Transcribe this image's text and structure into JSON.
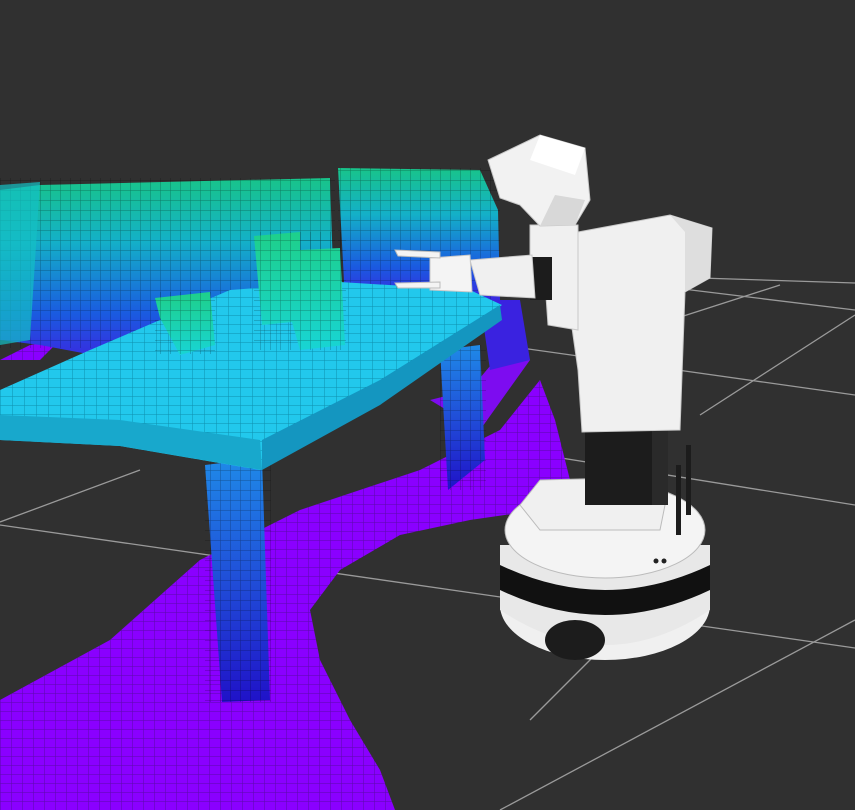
{
  "viewport": {
    "background": "#303030",
    "grid_color": "#a0a0a0"
  },
  "octomap": {
    "color_scheme": "height",
    "colors": {
      "floor": "#8a00ff",
      "floor_low": "#7a14e8",
      "table_leg_low": "#1a2bd8",
      "table_leg_high": "#1f7fe8",
      "table_top": "#22c8ec",
      "wall_low": "#1a3fe0",
      "wall_mid": "#1bb0d8",
      "wall_high": "#14b89a",
      "wall_top": "#18c48a",
      "object": "#1fcf90"
    }
  },
  "robot": {
    "name": "tiago",
    "colors": {
      "body": "#f0f0f0",
      "shade": "#c8c8c8",
      "dark": "#1c1c1c",
      "stripe": "#111111"
    }
  }
}
